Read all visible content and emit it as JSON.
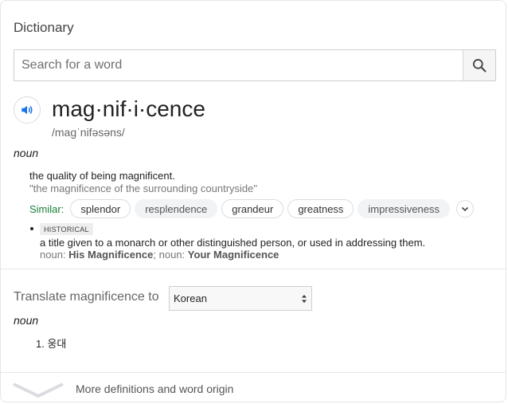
{
  "header": {
    "title": "Dictionary"
  },
  "search": {
    "placeholder": "Search for a word",
    "value": ""
  },
  "entry": {
    "word": "mag·nif·i·cence",
    "phonetic": "/maɡˈnifəsəns/",
    "part_of_speech": "noun",
    "sense1": {
      "definition": "the quality of being magnificent.",
      "example": "\"the magnificence of the surrounding countryside\""
    },
    "similar": {
      "label": "Similar:",
      "words": [
        "splendor",
        "resplendence",
        "grandeur",
        "greatness",
        "impressiveness"
      ]
    },
    "sense2": {
      "tag": "HISTORICAL",
      "definition": "a title given to a monarch or other distinguished person, or used in addressing them.",
      "form1_prefix": "noun:",
      "form1": "His Magnificence",
      "separator": ";",
      "form2_prefix": "noun:",
      "form2": "Your Magnificence"
    }
  },
  "translate": {
    "label": "Translate magnificence to",
    "language": "Korean",
    "part_of_speech": "noun",
    "results": [
      {
        "num": "1.",
        "text": "웅대"
      }
    ]
  },
  "footer": {
    "more_label": "More definitions and word origin"
  },
  "colors": {
    "similar_label": "#188038",
    "speaker_icon": "#1a73e8"
  }
}
